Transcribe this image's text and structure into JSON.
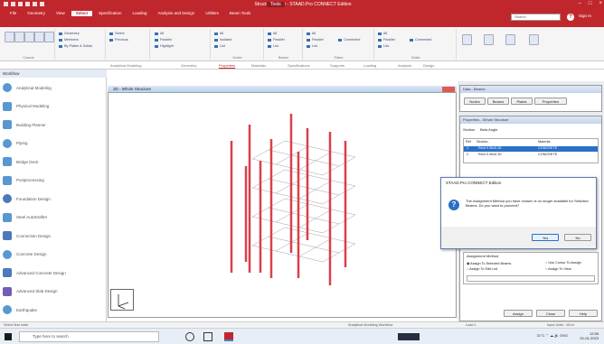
{
  "app": {
    "title": "Structure1.STD - STAAD.Pro CONNECT Edition",
    "tools_label": "Tools"
  },
  "menu_tabs": [
    "File",
    "Geometry",
    "View",
    "Select",
    "Specification",
    "Loading",
    "Analysis and Design",
    "Utilities",
    "Beam Tools"
  ],
  "active_tab_index": 3,
  "search_placeholder": "Search",
  "signin_label": "Sign In",
  "ribbon": {
    "groups": [
      {
        "label": "Cursors",
        "buttons": [
          "Nodes Cursor",
          "Beams Cursor",
          "Plates Cursor",
          "Solids Cursor",
          "Surface Cursor"
        ]
      },
      {
        "label": "",
        "items": [
          "Geometry",
          "Members",
          "By Plates & Solids"
        ]
      },
      {
        "label": "",
        "items": [
          "Select",
          "Previous"
        ]
      },
      {
        "label": "",
        "items": [
          "All",
          "Parallel",
          "Highlight"
        ]
      },
      {
        "label": "Nodes",
        "items": [
          "All",
          "Isolated",
          "List"
        ]
      },
      {
        "label": "Beams",
        "items": [
          "All",
          "Parallel",
          "List"
        ]
      },
      {
        "label": "Plates",
        "items": [
          "All",
          "Parallel",
          "Connected",
          "List"
        ]
      },
      {
        "label": "Solids",
        "items": [
          "All",
          "Parallel",
          "Connected",
          "List"
        ]
      },
      {
        "label": "",
        "buttons": [
          "Solids",
          "Other",
          "Workflows",
          "Modes"
        ]
      }
    ]
  },
  "view_tabs": [
    "Analytical Modeling",
    "Geometry",
    "Properties",
    "Materials",
    "Specifications",
    "Supports",
    "Loading",
    "Analysis",
    "Design"
  ],
  "active_view_tab_index": 2,
  "sidebar": {
    "header": "Workflow",
    "items": [
      {
        "label": "Analytical Modeling",
        "icon": "analytical-modeling-icon",
        "color": "#3a86c8"
      },
      {
        "label": "Physical Modeling",
        "icon": "physical-modeling-icon",
        "color": "#3a86c8"
      },
      {
        "label": "Building Planner",
        "icon": "building-planner-icon",
        "color": "#3a86c8"
      },
      {
        "label": "Piping",
        "icon": "piping-icon",
        "color": "#3a86c8"
      },
      {
        "label": "Bridge Deck",
        "icon": "bridge-deck-icon",
        "color": "#3a86c8"
      },
      {
        "label": "Postprocessing",
        "icon": "postprocessing-icon",
        "color": "#3a86c8"
      },
      {
        "label": "Foundation Design",
        "icon": "foundation-design-icon",
        "color": "#2b62b0"
      },
      {
        "label": "Steel AutoDrafter",
        "icon": "steel-autodrafter-icon",
        "color": "#3a86c8"
      },
      {
        "label": "Connection Design",
        "icon": "connection-design-icon",
        "color": "#2b62b0"
      },
      {
        "label": "Concrete Design",
        "icon": "concrete-design-icon",
        "color": "#3a86c8"
      },
      {
        "label": "Advanced Concrete Design",
        "icon": "advanced-concrete-design-icon",
        "color": "#2b62b0"
      },
      {
        "label": "Advanced Slab Design",
        "icon": "advanced-slab-design-icon",
        "color": "#5a3fa8"
      },
      {
        "label": "Earthquake",
        "icon": "earthquake-icon",
        "color": "#3a86c8"
      }
    ]
  },
  "viewport": {
    "title": "3D - Whole Structure"
  },
  "data_panel": {
    "title": "Data - Beams",
    "tabs": [
      "Nodes",
      "Beams",
      "Plates",
      "Properties"
    ]
  },
  "properties_panel": {
    "title": "Properties - Whole Structure",
    "section_tab": "Section",
    "beta_tab": "Beta Angle",
    "columns": [
      "Ref",
      "Section",
      "Material"
    ],
    "rows": [
      {
        "ref": "1",
        "section": "Rect 0.30x0.30",
        "material": "CONCRETE",
        "selected": true
      },
      {
        "ref": "2",
        "section": "Rect 0.30x0.30",
        "material": "CONCRETE",
        "selected": false
      }
    ]
  },
  "assign_panel": {
    "title": "Assignment Method",
    "options_left": [
      "Assign To Selected Beams",
      "Assign To Edit List"
    ],
    "options_right": [
      "Use Cursor To Assign",
      "Assign To View"
    ],
    "buttons": [
      "Assign",
      "Close",
      "Help"
    ]
  },
  "dialog": {
    "title": "STAAD.Pro CONNECT Edition",
    "message": "The Assignment Method you have chosen is no longer available for Selected Beams. Do you want to proceed?",
    "yes_label": "Yes",
    "no_label": "No"
  },
  "statusbar": {
    "left": "Select first node",
    "center": "Analytical Modeling Workflow",
    "load": "Load 1",
    "units": "Input Units : kN-m"
  },
  "taskbar": {
    "search_placeholder": "Type here to search",
    "weather": "31°C",
    "language": "ENG",
    "time": "12:55",
    "date": "01-01-2023"
  }
}
